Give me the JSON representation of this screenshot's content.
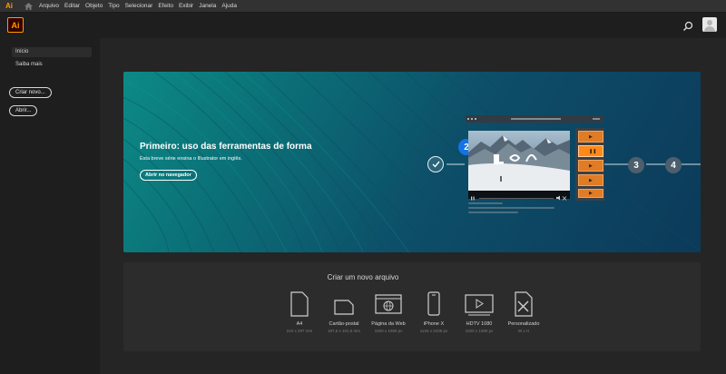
{
  "app": {
    "logo": "Ai",
    "menu_icon": "ai-icon",
    "home_icon": "home-icon"
  },
  "menu": [
    "Arquivo",
    "Editar",
    "Objeto",
    "Tipo",
    "Selecionar",
    "Efeito",
    "Exibir",
    "Janela",
    "Ajuda"
  ],
  "header": {
    "search_icon": "search-icon",
    "avatar_icon": "user-avatar"
  },
  "sidebar": {
    "items": [
      {
        "label": "Início",
        "active": true
      },
      {
        "label": "Saiba mais",
        "active": false
      }
    ],
    "create_button": "Criar novo...",
    "open_button": "Abrir..."
  },
  "hero": {
    "title": "Primeiro: uso das ferramentas de forma",
    "subtitle": "Esta breve série ensina o Illustrator em inglês.",
    "button": "Abrir no navegador",
    "steps": [
      {
        "label": "✓",
        "state": "done"
      },
      {
        "label": "2",
        "state": "current"
      },
      {
        "label": "3",
        "state": "upcoming"
      },
      {
        "label": "4",
        "state": "upcoming"
      }
    ],
    "accent_color": "#1473e6",
    "thumb_color": "#e07c25"
  },
  "new_file": {
    "title": "Criar um novo arquivo",
    "presets": [
      {
        "name": "A4",
        "size": "210 x 297 mm",
        "icon": "document-icon"
      },
      {
        "name": "Cartão-postal",
        "size": "197,6 x 101,6 mm",
        "icon": "postcard-icon"
      },
      {
        "name": "Página da Web",
        "size": "1920 x 1080 px",
        "icon": "web-page-icon"
      },
      {
        "name": "iPhone X",
        "size": "1125 x 2436 px",
        "icon": "phone-icon"
      },
      {
        "name": "HDTV 1080",
        "size": "1920 x 1080 px",
        "icon": "video-icon"
      },
      {
        "name": "Personalizado",
        "size": "W x H",
        "icon": "custom-size-icon"
      }
    ]
  }
}
